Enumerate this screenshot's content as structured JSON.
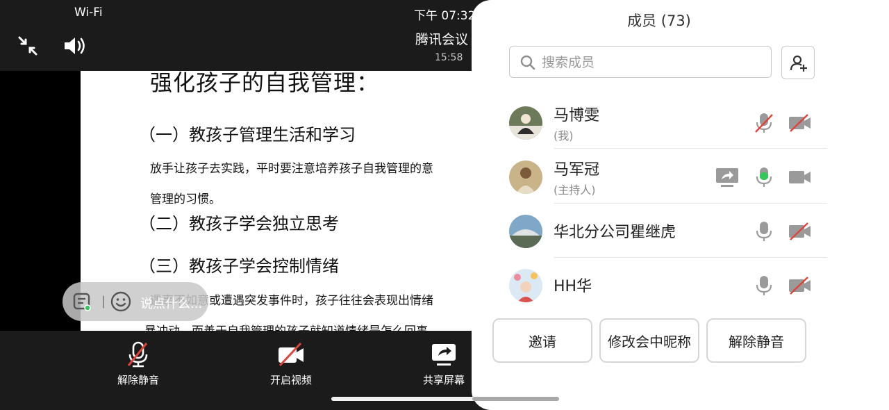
{
  "status": {
    "wifi": "Wi-Fi",
    "time": "下午 07:32"
  },
  "meeting": {
    "title": "腾讯会议",
    "timer": "15:58"
  },
  "slide": {
    "title": "强化孩子的自我管理：",
    "h1": "（一）教孩子管理生活和学习",
    "p1": "放手让孩子去实践，平时要注意培养孩子自我管理的意",
    "p2": "管理的习惯。",
    "h2": "（二）教孩子学会独立思考",
    "h3": "（三）教孩子学会控制情绪",
    "p3": "遇事不如意或遭遇突发事件时，孩子往往会表现出情绪",
    "p4": "暴冲动，而善于自我管理的孩子就知道情绪是怎么回事"
  },
  "chat": {
    "placeholder": "说点什么..."
  },
  "toolbar": {
    "unmute": "解除静音",
    "video": "开启视频",
    "share": "共享屏幕"
  },
  "panel": {
    "title": "成员 (73)",
    "search_placeholder": "搜索成员",
    "members": [
      {
        "name": "马博雯",
        "sub": "(我)"
      },
      {
        "name": "马军冠",
        "sub": "(主持人)"
      },
      {
        "name": "华北分公司瞿继虎",
        "sub": ""
      },
      {
        "name": "HH华",
        "sub": ""
      }
    ],
    "actions": {
      "invite": "邀请",
      "rename": "修改会中昵称",
      "unmute_all": "解除静音"
    }
  },
  "colors": {
    "accent_green": "#34c759",
    "mute_red": "#e0433c",
    "bar_bg": "#1b1b1c"
  }
}
